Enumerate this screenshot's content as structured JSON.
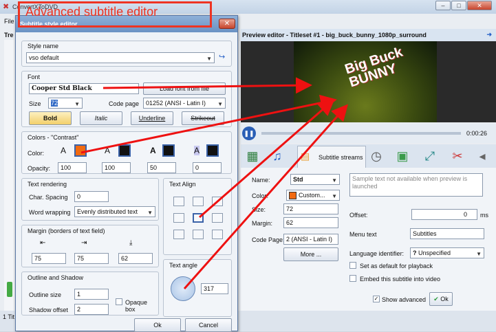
{
  "window": {
    "title": "ConvertXToDVD",
    "menu_file": "File",
    "tree_label": "Tre",
    "status_text": "1 Tit"
  },
  "banner": {
    "text": "Advanced subtitle editor"
  },
  "dialog": {
    "title": "Subtitle style editor",
    "close": "✕",
    "style_name_label": "Style name",
    "style_name_value": "vso default",
    "font_label": "Font",
    "font_name": "Cooper Std Black",
    "load_font_button": "Load font from file",
    "size_label": "Size",
    "size_value": "72",
    "codepage_label": "Code page",
    "codepage_value": "01252 (ANSI - Latin I)",
    "bold": "Bold",
    "italic": "Italic",
    "underline": "Underline",
    "strikeout": "Strikeout",
    "colors_label": "Colors - \"Contrast\"",
    "color_label": "Color:",
    "opacity_label": "Opacity:",
    "opacities": [
      "100",
      "100",
      "50",
      "0"
    ],
    "text_rendering_label": "Text rendering",
    "char_spacing_label": "Char. Spacing",
    "char_spacing_value": "0",
    "word_wrapping_label": "Word wrapping",
    "word_wrapping_value": "Evenly distributed text",
    "text_align_label": "Text Align",
    "margin_label": "Margin  (borders of text field)",
    "margins": [
      "75",
      "75",
      "62"
    ],
    "text_angle_label": "Text angle",
    "text_angle_value": "317",
    "outline_label": "Outline and Shadow",
    "outline_size_label": "Outline size",
    "outline_size_value": "1",
    "shadow_offset_label": "Shadow offset",
    "shadow_offset_value": "2",
    "opaque_box_label": "Opaque box",
    "ok": "Ok",
    "cancel": "Cancel"
  },
  "preview": {
    "header": "Preview editor - Titleset #1 - big_buck_bunny_1080p_surround",
    "time": "0:00:26",
    "overlay_title_1": "Big Buck",
    "overlay_title_2": "BUNNY"
  },
  "subtitle_panel": {
    "tab_label": "Subtitle streams",
    "name_label": "Name:",
    "name_value": "Std",
    "color_label": "Color:",
    "color_value": "Custom...",
    "size_label": "Size:",
    "size_value": "72",
    "margin_label": "Margin:",
    "margin_value": "62",
    "codepage_label": "Code Page:",
    "codepage_value": "2 (ANSI - Latin I)",
    "more_button": "More ...",
    "sample_text": "Sample text not available when preview is launched",
    "offset_label": "Offset:",
    "offset_value": "0",
    "offset_unit": "ms",
    "menu_text_label": "Menu text",
    "menu_text_value": "Subtitles",
    "language_label": "Language identifier:",
    "language_value": "Unspecified",
    "default_playback_label": "Set as default for playback",
    "embed_label": "Embed this subtitle into video",
    "show_advanced_label": "Show advanced",
    "ok": "Ok"
  },
  "colors": {
    "accent": "#e32",
    "swatch_orange": "#f26a10",
    "arrow": "#ee1111"
  }
}
